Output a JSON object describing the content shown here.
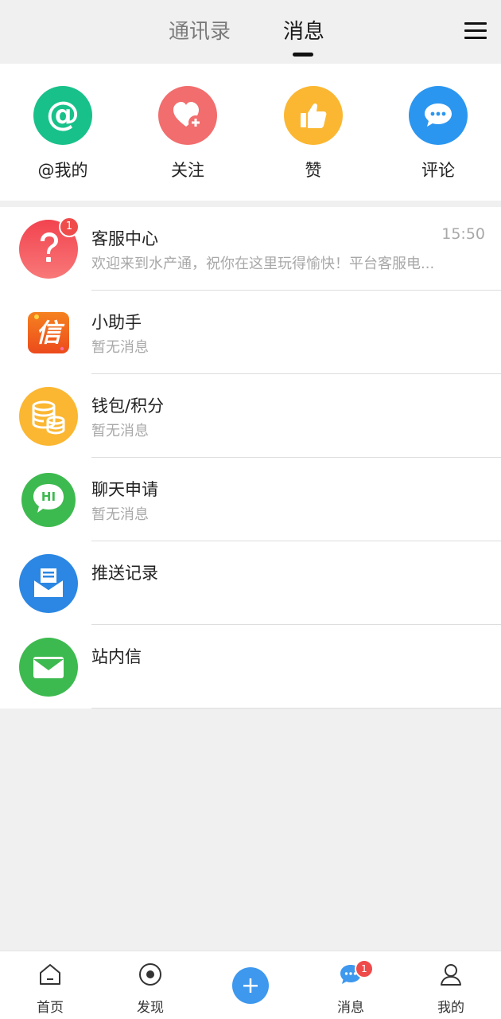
{
  "header": {
    "tabs": [
      {
        "label": "通讯录",
        "active": false
      },
      {
        "label": "消息",
        "active": true
      }
    ],
    "menu_icon": "hamburger-menu-icon"
  },
  "quick_actions": [
    {
      "label": "@我的",
      "icon": "at-icon",
      "color": "#18c18a"
    },
    {
      "label": "关注",
      "icon": "heart-plus-icon",
      "color": "#f26d6d"
    },
    {
      "label": "赞",
      "icon": "thumbs-up-icon",
      "color": "#fbb732"
    },
    {
      "label": "评论",
      "icon": "chat-bubble-icon",
      "color": "#2b96f0"
    }
  ],
  "conversations": [
    {
      "title": "客服中心",
      "subtitle": "欢迎来到水产通，祝你在这里玩得愉快！平台客服电...",
      "time": "15:50",
      "badge": "1",
      "icon": "question-mark-icon",
      "color": "#f24d55"
    },
    {
      "title": "小助手",
      "subtitle": "暂无消息",
      "time": "",
      "icon": "xin-logo-icon",
      "color": "#f06a1d",
      "logo_text": "信"
    },
    {
      "title": "钱包/积分",
      "subtitle": "暂无消息",
      "time": "",
      "icon": "coin-stack-icon",
      "color": "#fbb732"
    },
    {
      "title": "聊天申请",
      "subtitle": "暂无消息",
      "time": "",
      "icon": "hi-chat-icon",
      "color": "#3dba4f",
      "icon_text": "HI"
    },
    {
      "title": "推送记录",
      "subtitle": "",
      "time": "",
      "icon": "inbox-icon",
      "color": "#2b87e3"
    },
    {
      "title": "站内信",
      "subtitle": "",
      "time": "",
      "icon": "envelope-icon",
      "color": "#3dba4f"
    }
  ],
  "tabbar": {
    "items": [
      {
        "label": "首页",
        "icon": "home-icon"
      },
      {
        "label": "发现",
        "icon": "discover-icon"
      },
      {
        "label": "",
        "icon": "plus-icon"
      },
      {
        "label": "消息",
        "icon": "message-icon",
        "badge": "1"
      },
      {
        "label": "我的",
        "icon": "profile-icon"
      }
    ],
    "accent": "#3d98ee"
  }
}
